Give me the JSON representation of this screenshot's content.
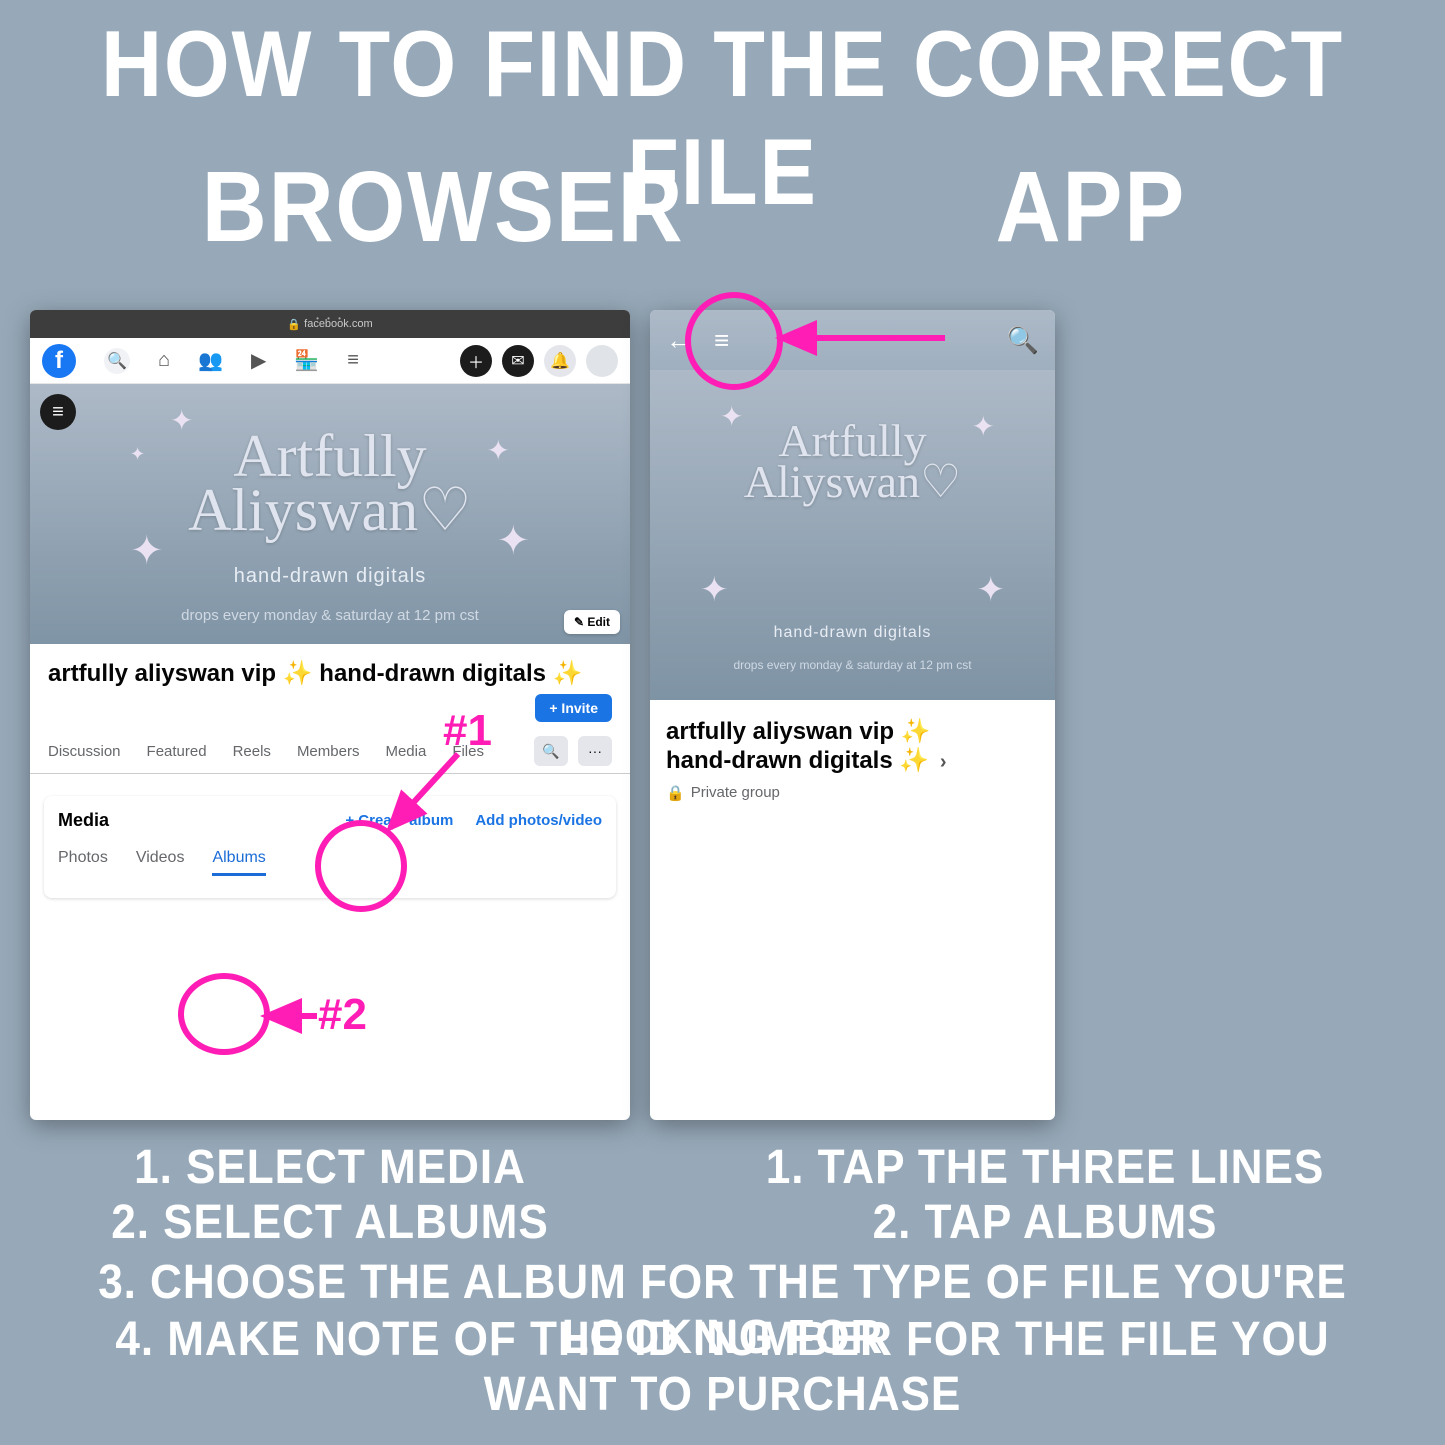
{
  "title": "HOW TO FIND THE CORRECT FILE",
  "columns": {
    "left": "BROWSER",
    "right": "APP"
  },
  "browser": {
    "url": "facebook.com",
    "group_title": "artfully aliyswan vip ✨ hand-drawn digitals ✨",
    "cover": {
      "script1": "Artfully",
      "script2": "Aliyswan♡",
      "sub": "hand-drawn digitals",
      "drops": "drops every monday & saturday at 12 pm cst"
    },
    "edit": "✎ Edit",
    "invite": "+ Invite",
    "tabs": [
      "Discussion",
      "Featured",
      "Reels",
      "Members",
      "Media",
      "Files"
    ],
    "media": {
      "heading": "Media",
      "create": "+  Create album",
      "add": "Add photos/video",
      "subtabs": [
        "Photos",
        "Videos",
        "Albums"
      ]
    }
  },
  "app": {
    "group_title_l1": "artfully aliyswan vip ✨",
    "group_title_l2": "hand-drawn digitals ✨",
    "private": "Private group",
    "cover": {
      "script1": "Artfully",
      "script2": "Aliyswan♡",
      "sub": "hand-drawn digitals",
      "drops": "drops every monday & saturday at 12 pm cst"
    }
  },
  "annotations": {
    "a1": "#1",
    "a2": "#2"
  },
  "instructions": {
    "left1": "1. SELECT MEDIA",
    "left2": "2. SELECT ALBUMS",
    "right1": "1. TAP THE THREE LINES",
    "right2": "2. TAP ALBUMS",
    "wide3": "3. CHOOSE THE ALBUM FOR THE TYPE OF FILE YOU'RE LOOKING FOR",
    "wide4": "4. MAKE NOTE OF THE ID NUMBER FOR THE FILE YOU WANT TO PURCHASE"
  }
}
